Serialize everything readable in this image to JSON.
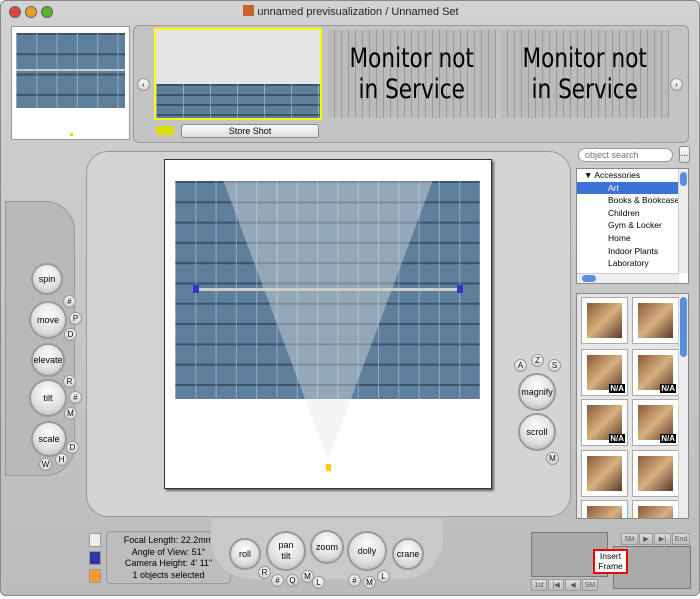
{
  "window": {
    "title": "unnamed previsualization / Unnamed Set"
  },
  "shots": {
    "store_label": "Store Shot",
    "monitors": [
      {
        "line1": "Monitor not",
        "line2": "in Service"
      },
      {
        "line1": "Monitor not",
        "line2": "in Service"
      }
    ]
  },
  "search": {
    "placeholder": "object search",
    "more_label": "..."
  },
  "library": {
    "category": "Accessories",
    "items": [
      "Art",
      "Books & Bookcases",
      "Children",
      "Gym & Locker",
      "Home",
      "Indoor Plants",
      "Laboratory"
    ],
    "selected": "Art"
  },
  "thumbnails": {
    "na_label": "N/A",
    "na_flags": [
      false,
      false,
      true,
      true,
      true,
      true,
      false,
      false,
      false,
      false
    ]
  },
  "left_controls": [
    "spin",
    "move",
    "elevate",
    "tilt",
    "scale"
  ],
  "left_keys": [
    "#",
    "P",
    "D",
    "R",
    "#",
    "M",
    "D",
    "W",
    "H"
  ],
  "right_controls": {
    "keys_top": [
      "A",
      "Z",
      "S"
    ],
    "magnify": "magnify",
    "scroll": "scroll",
    "key_bottom": "M"
  },
  "bottom_controls": {
    "roll": "roll",
    "pan_tilt": [
      "pan",
      "tilt"
    ],
    "zoom": "zoom",
    "dolly": "dolly",
    "crane": "crane",
    "keys": [
      "R",
      "#",
      "Q",
      "M",
      "L",
      "#",
      "M",
      "L"
    ]
  },
  "camera_info": {
    "focal_length": "Focal Length: 22.2mm",
    "angle_of_view": "Angle of View: 51°",
    "camera_height": "Camera Height: 4' 11\"",
    "selection": "1 objects selected"
  },
  "frames": {
    "insert_label_1": "Insert",
    "insert_label_2": "Frame",
    "nav_top": [
      "SM",
      "▶",
      "▶|",
      "End"
    ],
    "nav_bottom": [
      "1st",
      "|◀",
      "◀",
      "SM"
    ]
  },
  "colors": {
    "selection": "#3b73d6",
    "highlight_border": "#ffee00",
    "floor": "#5d7f9c",
    "insert_border": "#e00000"
  }
}
